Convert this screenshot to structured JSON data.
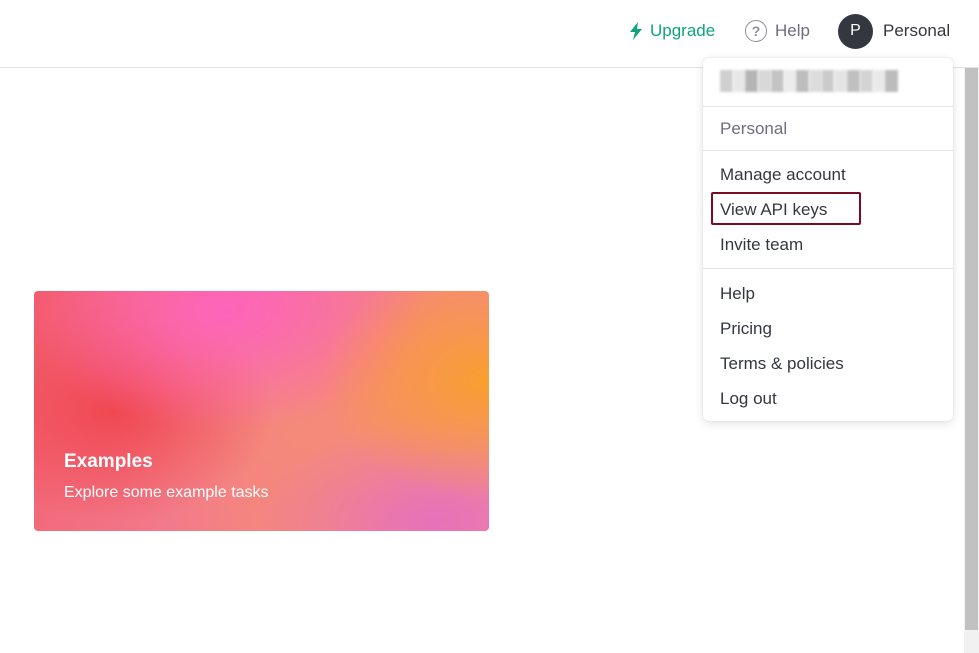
{
  "header": {
    "upgrade_label": "Upgrade",
    "help_label": "Help",
    "help_icon_glyph": "?",
    "avatar_initial": "P",
    "account_label": "Personal"
  },
  "card": {
    "title": "Examples",
    "subtitle": "Explore some example tasks"
  },
  "account_menu": {
    "org_name": "Personal",
    "items_group1": [
      "Manage account",
      "View API keys",
      "Invite team"
    ],
    "items_group2": [
      "Help",
      "Pricing",
      "Terms & policies",
      "Log out"
    ],
    "highlighted_item": "View API keys"
  },
  "colors": {
    "accent": "#10a37f",
    "text": "#353740",
    "muted": "#6e6e80",
    "highlight_border": "#7a0b22"
  },
  "icons": {
    "upgrade": "lightning-bolt-icon",
    "help": "question-circle-icon"
  }
}
